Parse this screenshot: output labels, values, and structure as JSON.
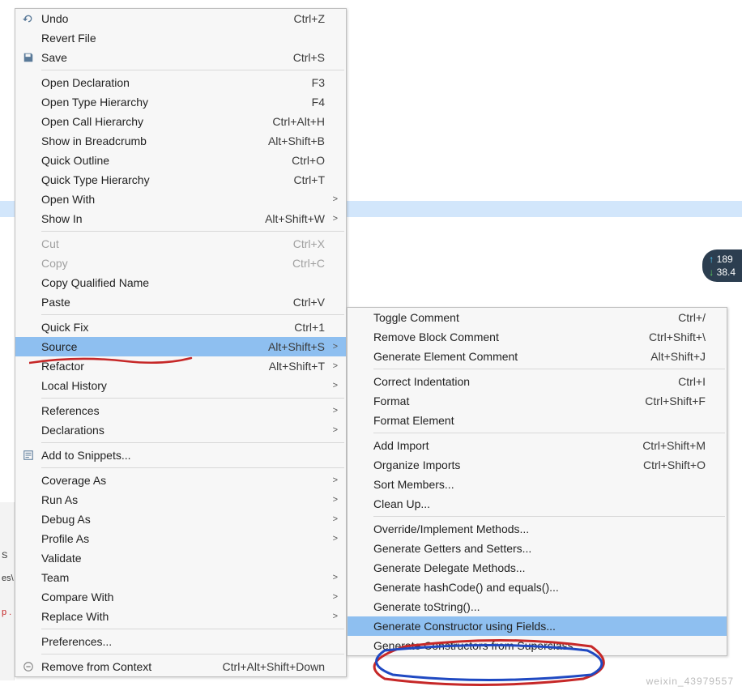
{
  "primary_menu": {
    "groups": [
      [
        {
          "icon": "undo",
          "label": "Undo",
          "shortcut": "Ctrl+Z"
        },
        {
          "label": "Revert File"
        },
        {
          "icon": "save",
          "label": "Save",
          "shortcut": "Ctrl+S"
        }
      ],
      [
        {
          "label": "Open Declaration",
          "shortcut": "F3"
        },
        {
          "label": "Open Type Hierarchy",
          "shortcut": "F4"
        },
        {
          "label": "Open Call Hierarchy",
          "shortcut": "Ctrl+Alt+H"
        },
        {
          "label": "Show in Breadcrumb",
          "shortcut": "Alt+Shift+B"
        },
        {
          "label": "Quick Outline",
          "shortcut": "Ctrl+O"
        },
        {
          "label": "Quick Type Hierarchy",
          "shortcut": "Ctrl+T"
        },
        {
          "label": "Open With",
          "submenu": true
        },
        {
          "label": "Show In",
          "shortcut": "Alt+Shift+W",
          "submenu": true
        }
      ],
      [
        {
          "label": "Cut",
          "shortcut": "Ctrl+X",
          "disabled": true
        },
        {
          "label": "Copy",
          "shortcut": "Ctrl+C",
          "disabled": true
        },
        {
          "label": "Copy Qualified Name"
        },
        {
          "label": "Paste",
          "shortcut": "Ctrl+V"
        }
      ],
      [
        {
          "label": "Quick Fix",
          "shortcut": "Ctrl+1"
        },
        {
          "label": "Source",
          "shortcut": "Alt+Shift+S",
          "submenu": true,
          "highlighted": true
        },
        {
          "label": "Refactor",
          "shortcut": "Alt+Shift+T",
          "submenu": true
        },
        {
          "label": "Local History",
          "submenu": true
        }
      ],
      [
        {
          "label": "References",
          "submenu": true
        },
        {
          "label": "Declarations",
          "submenu": true
        }
      ],
      [
        {
          "icon": "snippet",
          "label": "Add to Snippets..."
        }
      ],
      [
        {
          "label": "Coverage As",
          "submenu": true
        },
        {
          "label": "Run As",
          "submenu": true
        },
        {
          "label": "Debug As",
          "submenu": true
        },
        {
          "label": "Profile As",
          "submenu": true
        },
        {
          "label": "Validate"
        },
        {
          "label": "Team",
          "submenu": true
        },
        {
          "label": "Compare With",
          "submenu": true
        },
        {
          "label": "Replace With",
          "submenu": true
        }
      ],
      [
        {
          "label": "Preferences..."
        }
      ],
      [
        {
          "icon": "remove",
          "label": "Remove from Context",
          "shortcut": "Ctrl+Alt+Shift+Down"
        }
      ]
    ]
  },
  "secondary_menu": {
    "groups": [
      [
        {
          "label": "Toggle Comment",
          "shortcut": "Ctrl+/"
        },
        {
          "label": "Remove Block Comment",
          "shortcut": "Ctrl+Shift+\\"
        },
        {
          "label": "Generate Element Comment",
          "shortcut": "Alt+Shift+J"
        }
      ],
      [
        {
          "label": "Correct Indentation",
          "shortcut": "Ctrl+I"
        },
        {
          "label": "Format",
          "shortcut": "Ctrl+Shift+F"
        },
        {
          "label": "Format Element"
        }
      ],
      [
        {
          "label": "Add Import",
          "shortcut": "Ctrl+Shift+M"
        },
        {
          "label": "Organize Imports",
          "shortcut": "Ctrl+Shift+O"
        },
        {
          "label": "Sort Members..."
        },
        {
          "label": "Clean Up..."
        }
      ],
      [
        {
          "label": "Override/Implement Methods..."
        },
        {
          "label": "Generate Getters and Setters..."
        },
        {
          "label": "Generate Delegate Methods..."
        },
        {
          "label": "Generate hashCode() and equals()..."
        },
        {
          "label": "Generate toString()..."
        },
        {
          "label": "Generate Constructor using Fields...",
          "highlighted": true
        },
        {
          "label": "Generate Constructors from Superclass..."
        }
      ]
    ]
  },
  "network": {
    "up": "189",
    "down": "38.4"
  },
  "side": {
    "s": "S",
    "es": "es\\",
    "p": "p ."
  },
  "watermark": "weixin_43979557"
}
